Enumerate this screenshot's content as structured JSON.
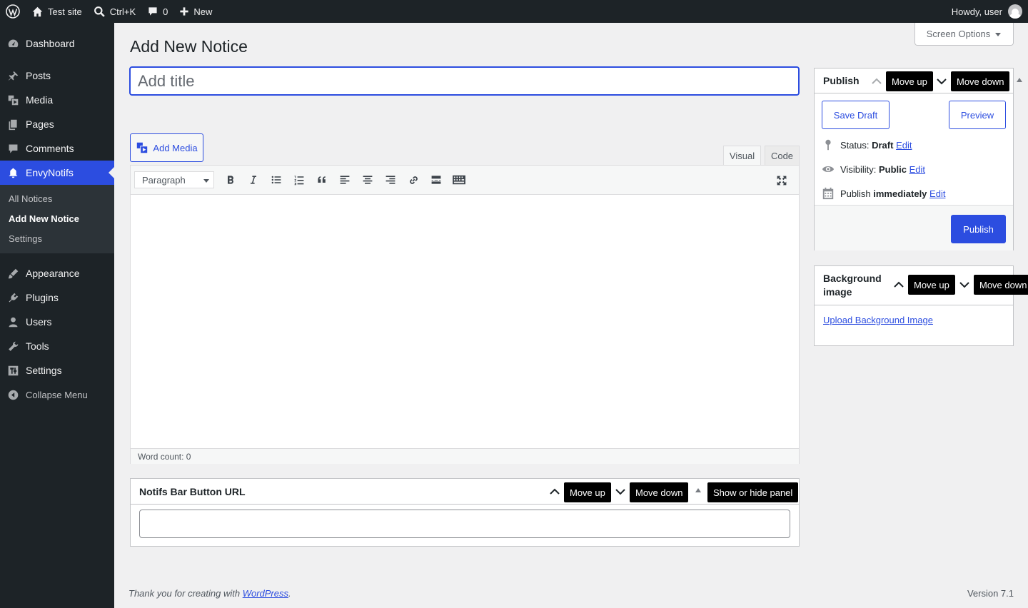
{
  "adminbar": {
    "site_name": "Test site",
    "search_shortcut": "Ctrl+K",
    "comments_count": "0",
    "new_label": "New",
    "howdy": "Howdy, user"
  },
  "sidebar": {
    "items": [
      {
        "label": "Dashboard",
        "icon": "dashboard-icon"
      },
      {
        "label": "Posts",
        "icon": "pin-icon"
      },
      {
        "label": "Media",
        "icon": "media-icon"
      },
      {
        "label": "Pages",
        "icon": "pages-icon"
      },
      {
        "label": "Comments",
        "icon": "comment-icon"
      },
      {
        "label": "EnvyNotifs",
        "icon": "bell-icon"
      },
      {
        "label": "Appearance",
        "icon": "brush-icon"
      },
      {
        "label": "Plugins",
        "icon": "plugin-icon"
      },
      {
        "label": "Users",
        "icon": "user-icon"
      },
      {
        "label": "Tools",
        "icon": "wrench-icon"
      },
      {
        "label": "Settings",
        "icon": "settings-icon"
      }
    ],
    "submenu": [
      "All Notices",
      "Add New Notice",
      "Settings"
    ],
    "collapse_label": "Collapse Menu"
  },
  "screen_options": "Screen Options",
  "page_title": "Add New Notice",
  "title_placeholder": "Add title",
  "editor": {
    "add_media": "Add Media",
    "tab_visual": "Visual",
    "tab_code": "Code",
    "format_value": "Paragraph",
    "word_count": "Word count: 0"
  },
  "url_box": {
    "title": "Notifs Bar Button URL",
    "move_up": "Move up",
    "move_down": "Move down",
    "toggle": "Show or hide panel"
  },
  "publish_box": {
    "title": "Publish",
    "move_up": "Move up",
    "move_down": "Move down",
    "save_draft": "Save Draft",
    "preview": "Preview",
    "status_label": "Status:",
    "status_value": "Draft",
    "visibility_label": "Visibility:",
    "visibility_value": "Public",
    "publish_label": "Publish",
    "publish_value": "immediately",
    "edit": "Edit",
    "publish_button": "Publish"
  },
  "bg_box": {
    "title": "Background image",
    "move_up": "Move up",
    "move_down": "Move down",
    "upload_link": "Upload Background Image"
  },
  "footer": {
    "thanks_prefix": "Thank you for creating with ",
    "thanks_link": "WordPress",
    "thanks_suffix": ".",
    "version": "Version 7.1"
  },
  "colors": {
    "accent": "#2c4de0",
    "adminbar": "#1d2327",
    "background": "#f0f0f1"
  }
}
